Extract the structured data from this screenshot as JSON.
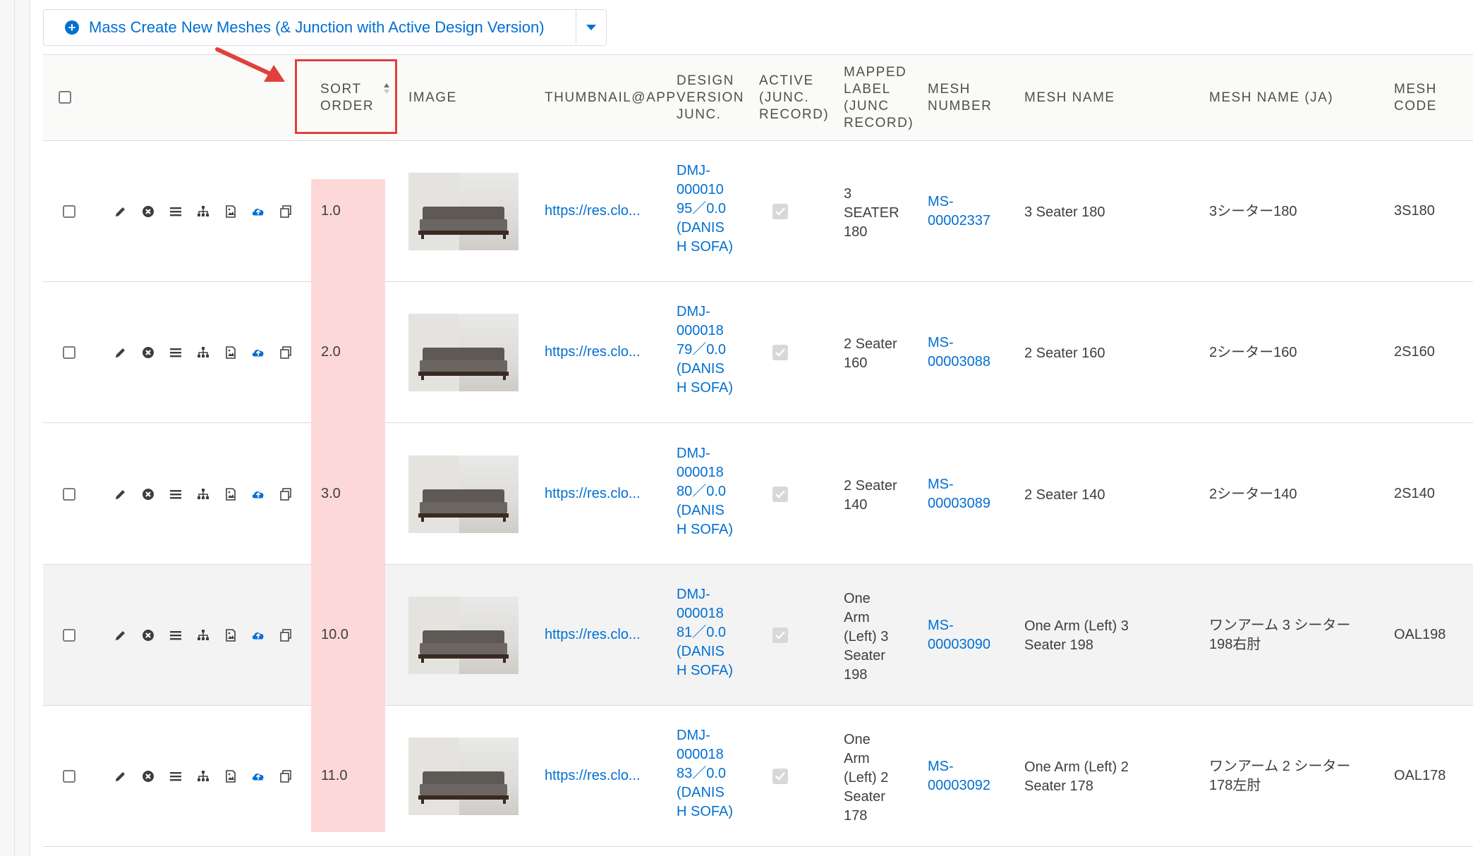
{
  "toolbar": {
    "mass_create_label": "Mass Create New Meshes (& Junction with Active Design Version)"
  },
  "columns": {
    "sort_order": [
      "SORT",
      "ORDER"
    ],
    "image": "IMAGE",
    "thumbnail": "THUMBNAIL@APP",
    "design_version": [
      "DESIGN",
      "VERSION",
      "JUNC."
    ],
    "active": [
      "ACTIVE",
      "(JUNC.",
      "RECORD)"
    ],
    "mapped_label": [
      "MAPPED",
      "LABEL",
      "(JUNC",
      "RECORD)"
    ],
    "mesh_number": [
      "MESH",
      "NUMBER"
    ],
    "mesh_name": "MESH NAME",
    "mesh_name_ja": "MESH NAME (JA)",
    "mesh_code": [
      "MESH",
      "CODE"
    ]
  },
  "rows": [
    {
      "sort": "1.0",
      "thumb": "https://res.clo...",
      "design": [
        "DMJ-",
        "000010",
        "95／0.0",
        "(DANIS",
        "H SOFA)"
      ],
      "mapped": [
        "3",
        "SEATER",
        "180"
      ],
      "mesh_no": [
        "MS-",
        "00002337"
      ],
      "name": [
        "3 Seater 180"
      ],
      "name_ja": [
        "3シーター180"
      ],
      "code": "3S180"
    },
    {
      "sort": "2.0",
      "thumb": "https://res.clo...",
      "design": [
        "DMJ-",
        "000018",
        "79／0.0",
        "(DANIS",
        "H SOFA)"
      ],
      "mapped": [
        "2 Seater",
        "160"
      ],
      "mesh_no": [
        "MS-",
        "00003088"
      ],
      "name": [
        "2 Seater 160"
      ],
      "name_ja": [
        "2シーター160"
      ],
      "code": "2S160"
    },
    {
      "sort": "3.0",
      "thumb": "https://res.clo...",
      "design": [
        "DMJ-",
        "000018",
        "80／0.0",
        "(DANIS",
        "H SOFA)"
      ],
      "mapped": [
        "2 Seater",
        "140"
      ],
      "mesh_no": [
        "MS-",
        "00003089"
      ],
      "name": [
        "2 Seater 140"
      ],
      "name_ja": [
        "2シーター140"
      ],
      "code": "2S140"
    },
    {
      "sort": "10.0",
      "thumb": "https://res.clo...",
      "design": [
        "DMJ-",
        "000018",
        "81／0.0",
        "(DANIS",
        "H SOFA)"
      ],
      "mapped": [
        "One",
        "Arm",
        "(Left) 3",
        "Seater",
        "198"
      ],
      "mesh_no": [
        "MS-",
        "00003090"
      ],
      "name": [
        "One Arm (Left) 3",
        "Seater 198"
      ],
      "name_ja": [
        "ワンアーム 3 シーター",
        "198右肘"
      ],
      "code": "OAL198"
    },
    {
      "sort": "11.0",
      "thumb": "https://res.clo...",
      "design": [
        "DMJ-",
        "000018",
        "83／0.0",
        "(DANIS",
        "H SOFA)"
      ],
      "mapped": [
        "One",
        "Arm",
        "(Left) 2",
        "Seater",
        "178"
      ],
      "mesh_no": [
        "MS-",
        "00003092"
      ],
      "name": [
        "One Arm (Left) 2",
        "Seater 178"
      ],
      "name_ja": [
        "ワンアーム 2 シーター",
        "178左肘"
      ],
      "code": "OAL178"
    }
  ],
  "row_icons": [
    "pencil-icon",
    "remove-icon",
    "list-icon",
    "hierarchy-icon",
    "image-icon",
    "upload-cloud-icon",
    "copy-icon"
  ],
  "colors": {
    "link": "#0070d2",
    "highlight": "#fdd8d8",
    "annotation": "#e0403c"
  }
}
